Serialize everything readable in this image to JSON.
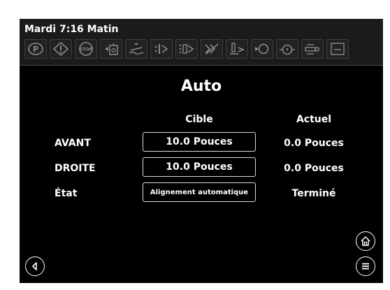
{
  "header": {
    "datetime": "Mardi 7:16 Matin",
    "indicators": [
      {
        "icon": "parking-brake-icon"
      },
      {
        "icon": "warning-icon"
      },
      {
        "icon": "stop-icon",
        "text": "STOP"
      },
      {
        "icon": "hydraulic-oil-icon"
      },
      {
        "icon": "level-icon"
      },
      {
        "icon": "sensor-1-icon"
      },
      {
        "icon": "sensor-2-icon"
      },
      {
        "icon": "sensor-3-icon"
      },
      {
        "icon": "jack-icon"
      },
      {
        "icon": "circle-arrow-icon"
      },
      {
        "icon": "oil-drop-icon"
      },
      {
        "icon": "hitch-icon"
      },
      {
        "icon": "screen-icon"
      }
    ]
  },
  "main": {
    "title": "Auto",
    "col_target": "Cible",
    "col_actual": "Actuel",
    "rows": [
      {
        "label": "AVANT",
        "target": "10.0 Pouces",
        "actual": "0.0 Pouces"
      },
      {
        "label": "DROITE",
        "target": "10.0 Pouces",
        "actual": "0.0 Pouces"
      },
      {
        "label": "État",
        "target": "Alignement automatique",
        "actual": "Terminé"
      }
    ]
  },
  "colors": {
    "background": "#000000",
    "header": "#1b1b1b",
    "text": "#ffffff",
    "icon": "#8a8a8a"
  }
}
